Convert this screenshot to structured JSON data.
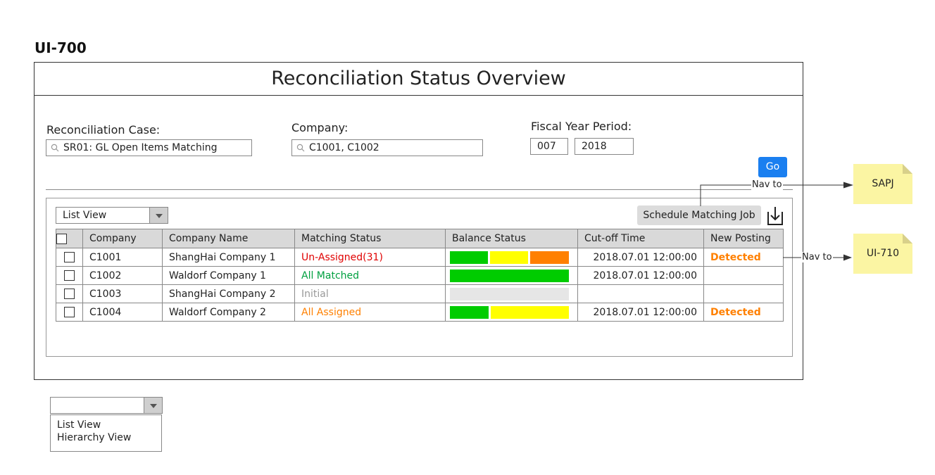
{
  "screen_id": "UI-700",
  "title": "Reconciliation Status Overview",
  "filters": {
    "reconciliation_case": {
      "label": "Reconciliation Case:",
      "value": "SR01: GL Open Items Matching"
    },
    "company": {
      "label": "Company:",
      "value": "C1001, C1002"
    },
    "fiscal_year_period": {
      "label": "Fiscal Year Period:",
      "period": "007",
      "year": "2018"
    },
    "go_label": "Go"
  },
  "toolbar": {
    "view_select": "List View",
    "schedule_label": "Schedule Matching Job",
    "download_icon": "download-icon"
  },
  "table": {
    "columns": [
      "Company",
      "Company Name",
      "Matching Status",
      "Balance Status",
      "Cut-off Time",
      "New Posting"
    ],
    "rows": [
      {
        "company": "C1001",
        "name": "ShangHai Company 1",
        "status": "Un-Assigned(31)",
        "status_color": "#e00000",
        "balance": [
          {
            "color": "#00cc00",
            "frac": 0.33
          },
          {
            "color": "#ffff00",
            "frac": 0.33
          },
          {
            "color": "#ff8000",
            "frac": 0.34
          }
        ],
        "cutoff": "2018.07.01 12:00:00",
        "posting": "Detected"
      },
      {
        "company": "C1002",
        "name": "Waldorf Company 1",
        "status": "All Matched",
        "status_color": "#00a040",
        "balance": [
          {
            "color": "#00cc00",
            "frac": 1.0
          }
        ],
        "cutoff": "2018.07.01 12:00:00",
        "posting": ""
      },
      {
        "company": "C1003",
        "name": "ShangHai Company 2",
        "status": "Initial",
        "status_color": "#999999",
        "balance": [
          {
            "color": "#e6e6e6",
            "frac": 1.0
          }
        ],
        "cutoff": "",
        "posting": ""
      },
      {
        "company": "C1004",
        "name": "Waldorf Company 2",
        "status": "All Assigned",
        "status_color": "#ff8000",
        "balance": [
          {
            "color": "#00cc00",
            "frac": 0.33
          },
          {
            "color": "#ffff00",
            "frac": 0.67
          }
        ],
        "cutoff": "2018.07.01 12:00:00",
        "posting": "Detected"
      }
    ]
  },
  "annotations": {
    "nav_to_1": "Nav to",
    "note_1": "SAPJ",
    "nav_to_2": "Nav to",
    "note_2": "UI-710"
  },
  "dropdown_popup": {
    "selected": "",
    "options": [
      "List View",
      "Hierarchy View"
    ]
  }
}
